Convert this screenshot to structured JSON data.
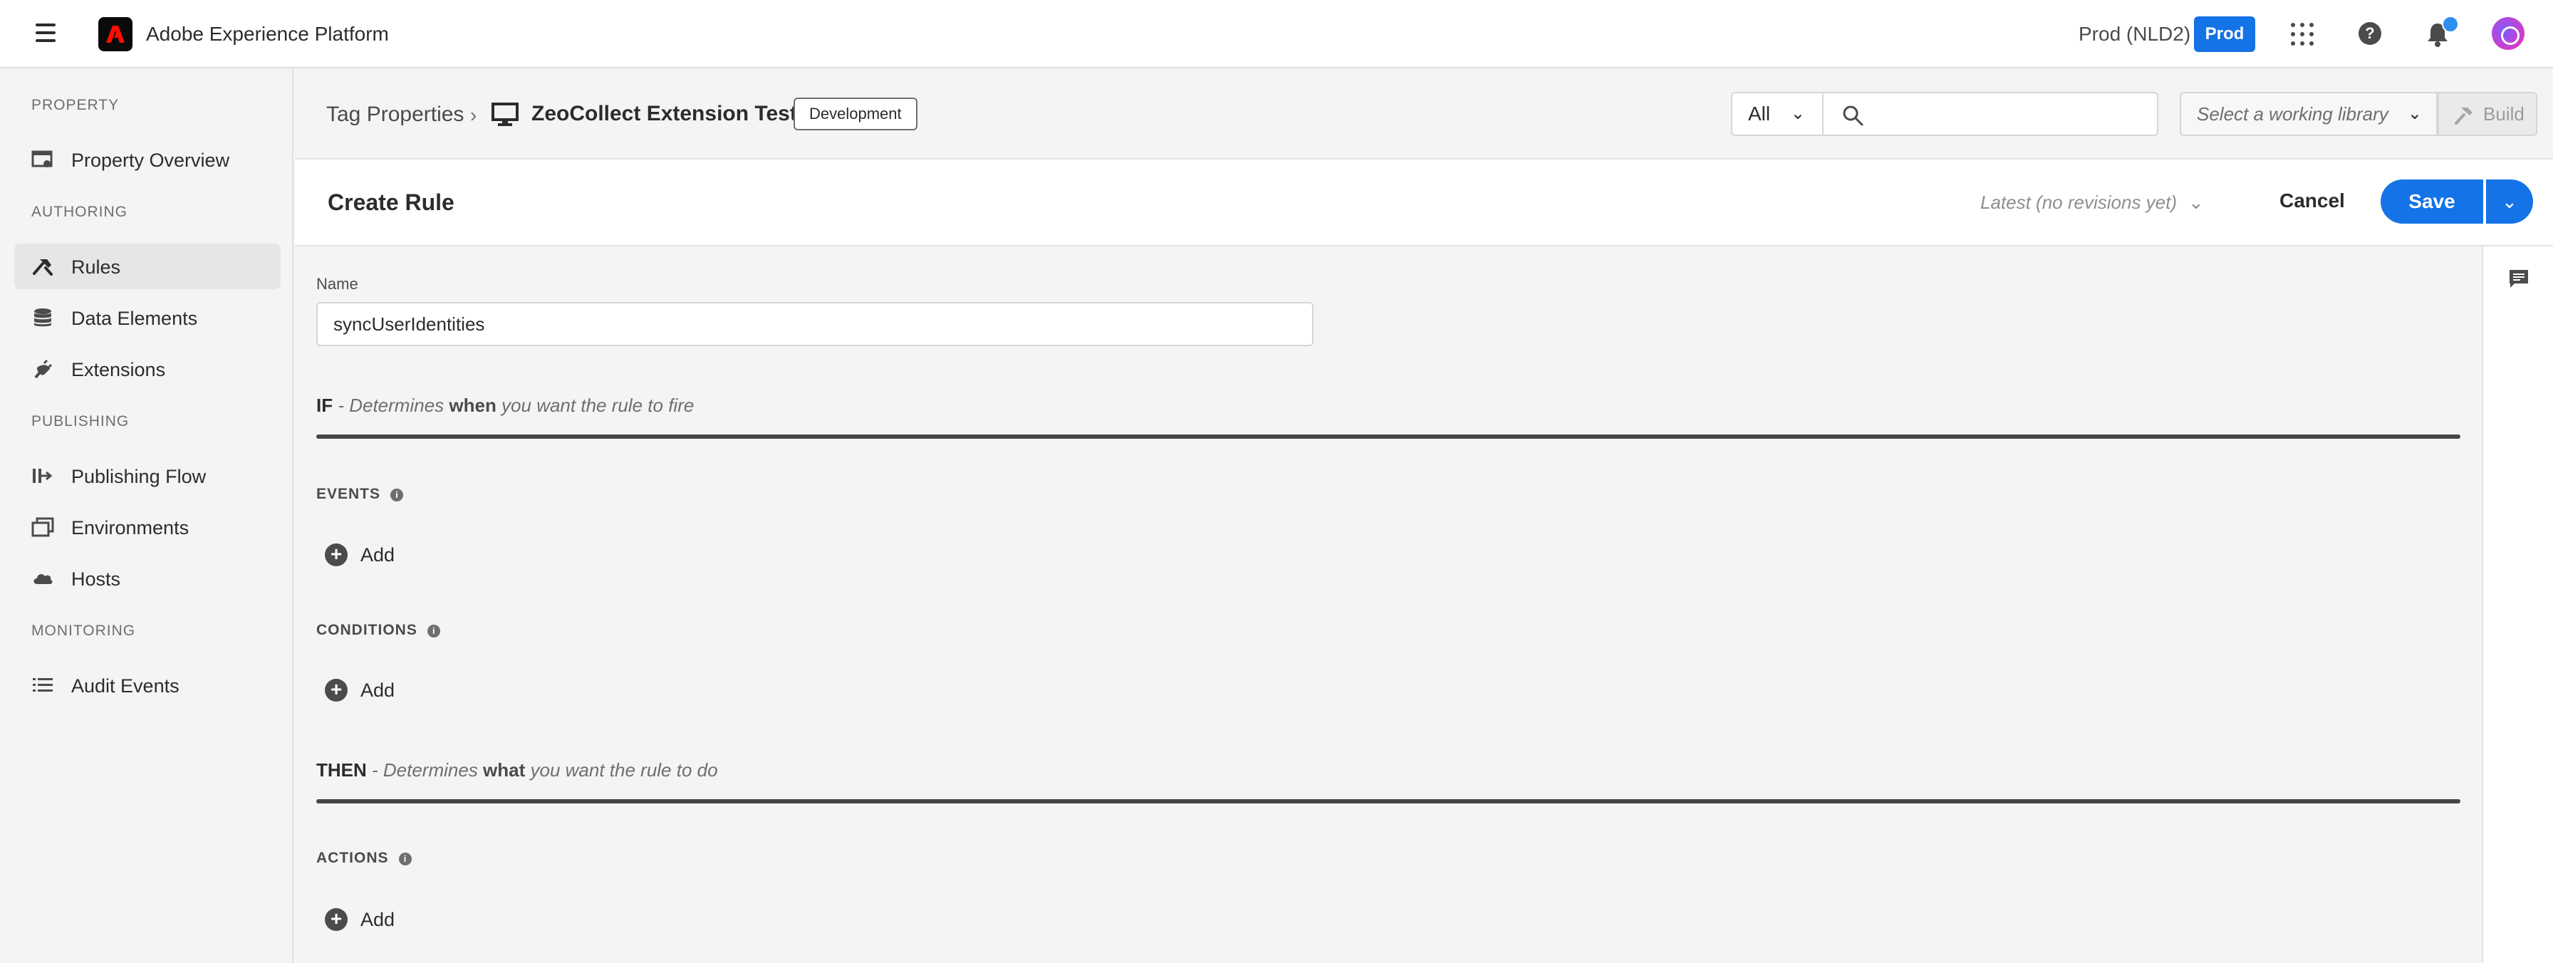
{
  "app": {
    "title": "Adobe Experience Platform",
    "environment_label": "Prod (NLD2)",
    "environment_badge": "Prod"
  },
  "sidebar": {
    "sections": [
      {
        "label": "PROPERTY"
      },
      {
        "label": "AUTHORING"
      },
      {
        "label": "PUBLISHING"
      },
      {
        "label": "MONITORING"
      }
    ],
    "items": [
      {
        "label": "Property Overview",
        "icon": "property-icon"
      },
      {
        "label": "Rules",
        "icon": "rules-icon",
        "active": true
      },
      {
        "label": "Data Elements",
        "icon": "database-icon"
      },
      {
        "label": "Extensions",
        "icon": "plug-icon"
      },
      {
        "label": "Publishing Flow",
        "icon": "flow-icon"
      },
      {
        "label": "Environments",
        "icon": "environments-icon"
      },
      {
        "label": "Hosts",
        "icon": "cloud-icon"
      },
      {
        "label": "Audit Events",
        "icon": "list-icon"
      }
    ]
  },
  "breadcrumb": {
    "root": "Tag Properties",
    "property": "ZeoCollect Extension Test",
    "badge": "Development"
  },
  "search": {
    "filter_value": "All",
    "placeholder": ""
  },
  "library": {
    "placeholder": "Select a working library",
    "build_label": "Build"
  },
  "rule": {
    "title": "Create Rule",
    "revision": "Latest (no revisions yet)",
    "cancel_label": "Cancel",
    "save_label": "Save",
    "name_label": "Name",
    "name_value": "syncUserIdentities"
  },
  "if_clause": {
    "keyword": "IF",
    "prefix": " - Determines ",
    "emphasis": "when",
    "suffix": " you want the rule to fire"
  },
  "then_clause": {
    "keyword": "THEN",
    "prefix": " - Determines ",
    "emphasis": "what",
    "suffix": " you want the rule to do"
  },
  "sections": {
    "events": {
      "heading": "EVENTS",
      "add_label": "Add"
    },
    "conditions": {
      "heading": "CONDITIONS",
      "add_label": "Add"
    },
    "actions": {
      "heading": "ACTIONS",
      "add_label": "Add"
    }
  },
  "colors": {
    "accent": "#1473e6",
    "divider": "#464646",
    "background": "#f4f4f4"
  }
}
